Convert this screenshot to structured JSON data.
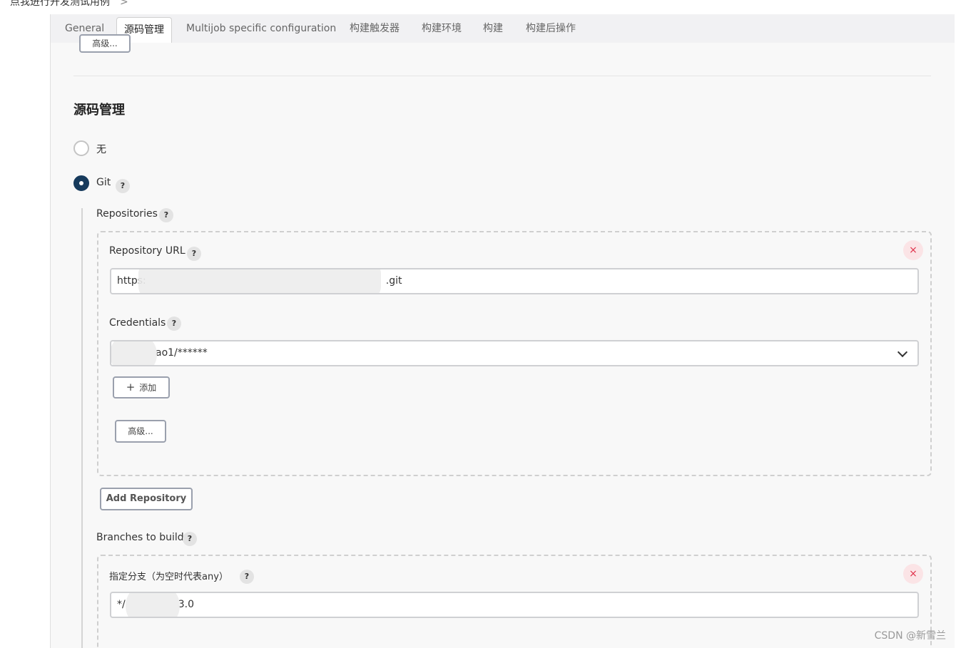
{
  "breadcrumb": {
    "text": "点我进行开发测试用例",
    "chevron": ">"
  },
  "tabs": [
    {
      "label": "General",
      "active": false
    },
    {
      "label": "源码管理",
      "active": true
    },
    {
      "label": "Multijob specific configuration",
      "active": false
    },
    {
      "label": "构建触发器",
      "active": false
    },
    {
      "label": "构建环境",
      "active": false
    },
    {
      "label": "构建",
      "active": false
    },
    {
      "label": "构建后操作",
      "active": false
    }
  ],
  "top_advanced_label": "高级...",
  "section_title": "源码管理",
  "scm_options": [
    {
      "label": "无",
      "selected": false
    },
    {
      "label": "Git",
      "selected": true
    }
  ],
  "help_glyph": "?",
  "remove_glyph": "×",
  "repositories": {
    "label": "Repositories",
    "url_label": "Repository URL",
    "url_value_prefix": "https:",
    "url_value_suffix": ".git",
    "credentials_label": "Credentials",
    "credentials_value": "ao1/******",
    "add_label": "添加",
    "add_icon": "+",
    "advanced_label": "高级...",
    "add_repository_label": "Add Repository"
  },
  "branches": {
    "label": "Branches to build",
    "spec_label": "指定分支（为空时代表any）",
    "spec_value_prefix": "*/",
    "spec_value_suffix": "3.0"
  },
  "watermark": "CSDN @新雪兰",
  "colors": {
    "radio_checked": "#163a5c",
    "remove_bg": "#fbe4e6",
    "remove_fg": "#e0304a"
  }
}
